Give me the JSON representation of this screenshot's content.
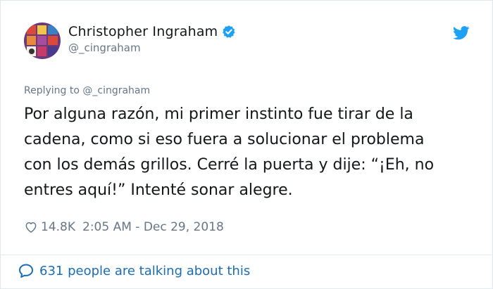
{
  "author": {
    "display_name": "Christopher Ingraham",
    "handle": "@_cingraham",
    "verified_icon": "verified-badge-icon",
    "avatar_icon": "avatar-image"
  },
  "platform_icon": "twitter-bird-icon",
  "reply": {
    "replying_to": "Replying to @_cingraham"
  },
  "tweet": {
    "text": "Por alguna razón, mi primer instinto fue tirar de la\ncadena, como si eso fuera a solucionar el problema\ncon los demás grillos. Cerré la puerta y dije: “¡Eh, no\nentres aquí!” Intenté sonar alegre."
  },
  "meta": {
    "likes": "14.8K",
    "timestamp": "2:05 AM - Dec 29, 2018"
  },
  "conversation": {
    "text": "631 people are talking about this"
  },
  "colors": {
    "accent": "#1da1f2",
    "link": "#1b6db3",
    "muted": "#657786",
    "text": "#14171a",
    "border": "#e1e8ed"
  }
}
